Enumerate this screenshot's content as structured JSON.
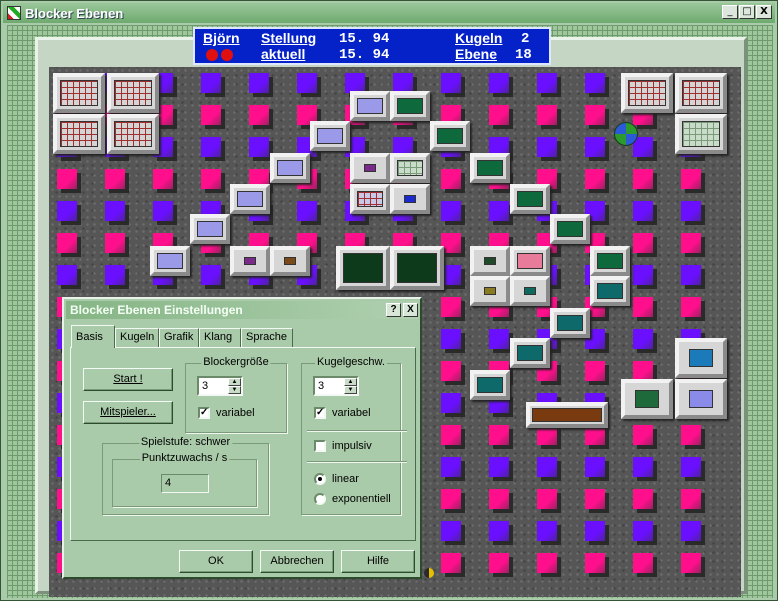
{
  "window": {
    "title": "Blocker Ebenen",
    "minimize": "_",
    "maximize": "□",
    "close": "X"
  },
  "scoreboard": {
    "player": "Björn",
    "lives": 2,
    "stellung_label": "Stellung",
    "stellung_value": "15. 94",
    "aktuell_label": "aktuell",
    "aktuell_value": "15. 94",
    "kugeln_label": "Kugeln",
    "kugeln_value": "2",
    "ebene_label": "Ebene",
    "ebene_value": "18"
  },
  "colors": {
    "pink": "#ff0f8c",
    "violet": "#6a10ff",
    "board": "#0522c8",
    "dialog": "#aacbaa"
  },
  "dialog": {
    "title": "Blocker Ebenen Einstellungen",
    "help_btn": "?",
    "close_btn": "X",
    "tabs": [
      "Basis",
      "Kugeln",
      "Grafik",
      "Klang",
      "Sprache"
    ],
    "active_tab": "Basis",
    "start_button": "Start !",
    "mitspieler_button": "Mitspieler...",
    "blockergroesse": {
      "label": "Blockergröße",
      "value": "3",
      "variabel_label": "variabel",
      "variabel_checked": true
    },
    "kugelgeschw": {
      "label": "Kugelgeschw.",
      "value": "3",
      "variabel_label": "variabel",
      "variabel_checked": true,
      "impulsiv_label": "impulsiv",
      "impulsiv_checked": false,
      "linear_label": "linear",
      "exponentiell_label": "exponentiell",
      "selected": "linear"
    },
    "spielstufe": {
      "label": "Spielstufe: schwer",
      "punktzuwachs_label": "Punktzuwachs / s",
      "punktzuwachs_value": "4"
    },
    "ok": "OK",
    "abbrechen": "Abbrechen",
    "hilfe": "Hilfe"
  }
}
